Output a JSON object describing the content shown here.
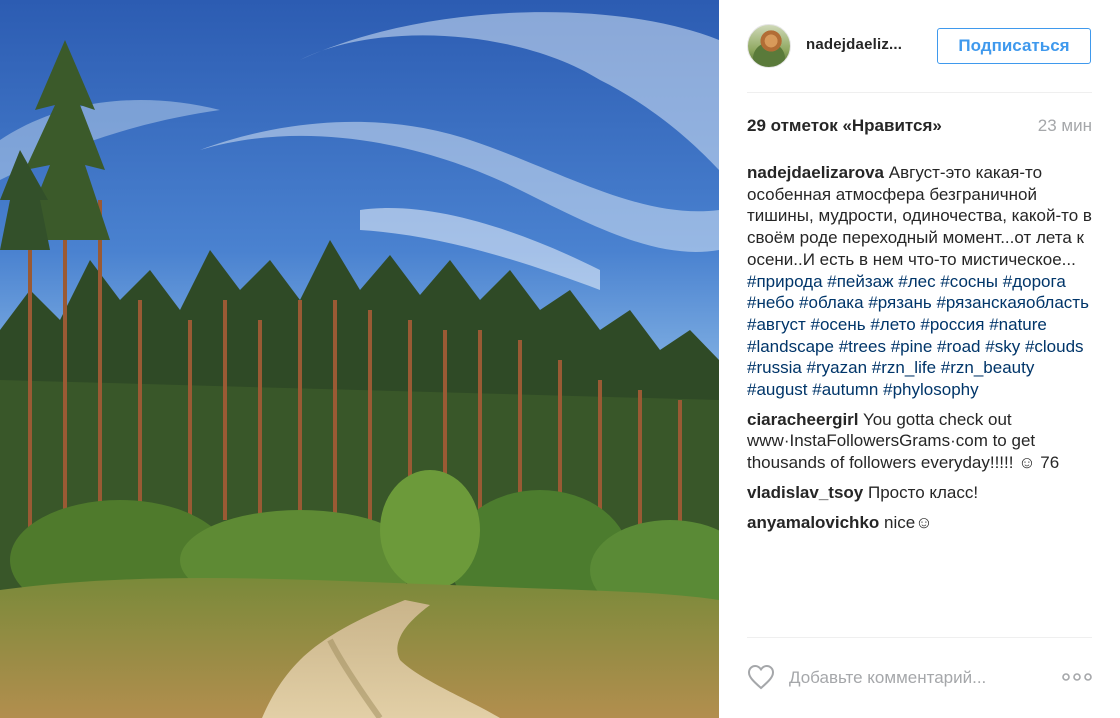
{
  "post": {
    "photo_alt": "Фото",
    "author": {
      "username_short": "nadejdaeliz...",
      "follow_label": "Подписаться"
    },
    "likes_text": "29 отметок «Нравится»",
    "time_ago": "23 мин",
    "caption": {
      "user": "nadejdaelizarova",
      "text": "Август-это какая-то особенная атмосфера безграничной тишины, мудрости, одиночества, какой-то в своём роде переходный момент...от лета к осени..И есть в нем что-то мистическое...",
      "hashtags": [
        "#природа",
        "#пейзаж",
        "#лес",
        "#сосны",
        "#дорога",
        "#небо",
        "#облака",
        "#рязань",
        "#рязанскаяобласть",
        "#август",
        "#осень",
        "#лето",
        "#россия",
        "#nature",
        "#landscape",
        "#trees",
        "#pine",
        "#road",
        "#sky",
        "#clouds",
        "#russia",
        "#ryazan",
        "#rzn_life",
        "#rzn_beauty",
        "#august",
        "#autumn",
        "#phylosophy"
      ]
    },
    "comments": [
      {
        "user": "ciaracheergirl",
        "text": "You gotta check out www·InstaFollowersGrams·com to get thousands of followers everyday!!!!! ☺ 76"
      },
      {
        "user": "vladislav_tsoy",
        "text": "Просто класс!"
      },
      {
        "user": "anyamalovichko",
        "text": "nice☺"
      }
    ],
    "add_comment_placeholder": "Добавьте комментарий..."
  },
  "colors": {
    "accent_blue": "#3f99ed",
    "hashtag": "#003569",
    "muted": "#a5a7aa"
  },
  "icons": {
    "like": "heart-outline-icon",
    "options": "more-options-icon"
  }
}
